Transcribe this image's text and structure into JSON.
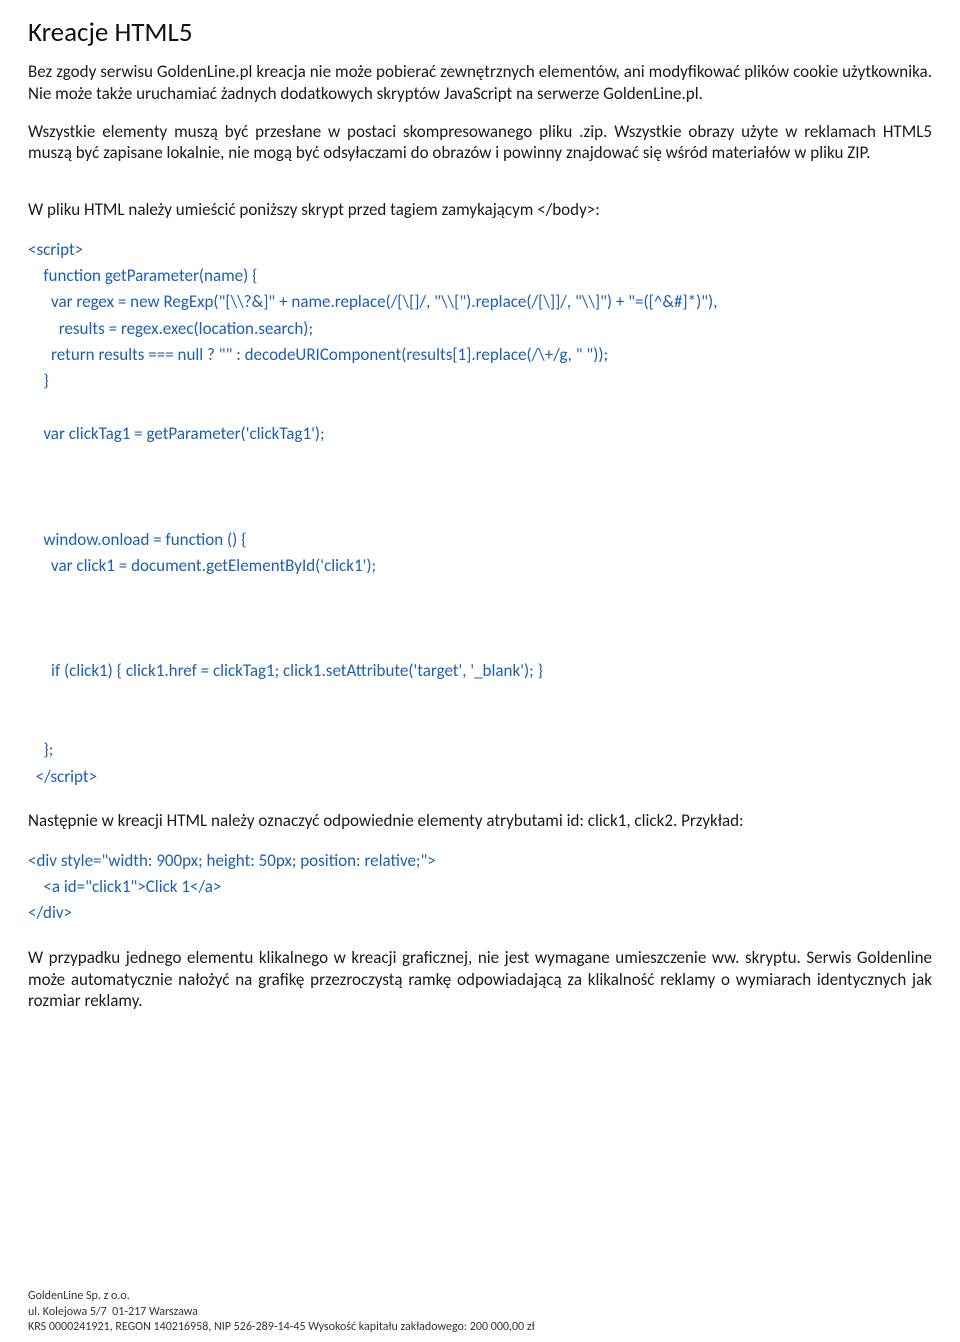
{
  "title": "Kreacje HTML5",
  "para1": "Bez zgody serwisu GoldenLine.pl kreacja nie może pobierać zewnętrznych elementów, ani modyfikować plików cookie użytkownika. Nie może także uruchamiać żadnych dodatkowych skryptów JavaScript na serwerze GoldenLine.pl.",
  "para2": "Wszystkie elementy muszą być przesłane w postaci skompresowanego pliku .zip. Wszystkie obrazy użyte w reklamach HTML5 muszą być zapisane lokalnie, nie mogą być odsyłaczami do obrazów i powinny znajdować się wśród materiałów w pliku ZIP.",
  "para3": "W pliku HTML należy umieścić poniższy skrypt przed tagiem zamykającym </body>:",
  "code1": "<script>\n    function getParameter(name) {\n      var regex = new RegExp(\"[\\\\?&]\" + name.replace(/[\\[]/, \"\\\\[\").replace(/[\\]]/, \"\\\\]\") + \"=([^&#]*)\"),\n        results = regex.exec(location.search);\n      return results === null ? \"\" : decodeURIComponent(results[1].replace(/\\+/g, \" \"));\n    }\n\n    var clickTag1 = getParameter('clickTag1');\n\n\n\n    window.onload = function () {\n      var click1 = document.getElementById('click1');\n\n\n\n      if (click1) { click1.href = clickTag1; click1.setAttribute('target', '_blank'); }\n\n\n    };\n  </script>",
  "para4": "Następnie w kreacji HTML należy oznaczyć odpowiednie elementy atrybutami id: click1, click2. Przykład:",
  "code2": "<div style=\"width: 900px; height: 50px; position: relative;\">\n    <a id=\"click1\">Click 1</a>\n</div>",
  "para5": "W przypadku jednego elementu klikalnego w kreacji graficznej, nie jest wymagane umieszczenie ww. skryptu. Serwis Goldenline może automatycznie nałożyć na grafikę przezroczystą ramkę odpowiadającą za klikalność reklamy o wymiarach identycznych jak rozmiar reklamy.",
  "footer": {
    "line1": "GoldenLine Sp. z o.o.",
    "line2": "ul. Kolejowa 5/7  01-217 Warszawa",
    "line3": "KRS 0000241921, REGON 140216958, NIP 526-289-14-45 Wysokość kapitału zakładowego: 200 000,00 zł"
  }
}
